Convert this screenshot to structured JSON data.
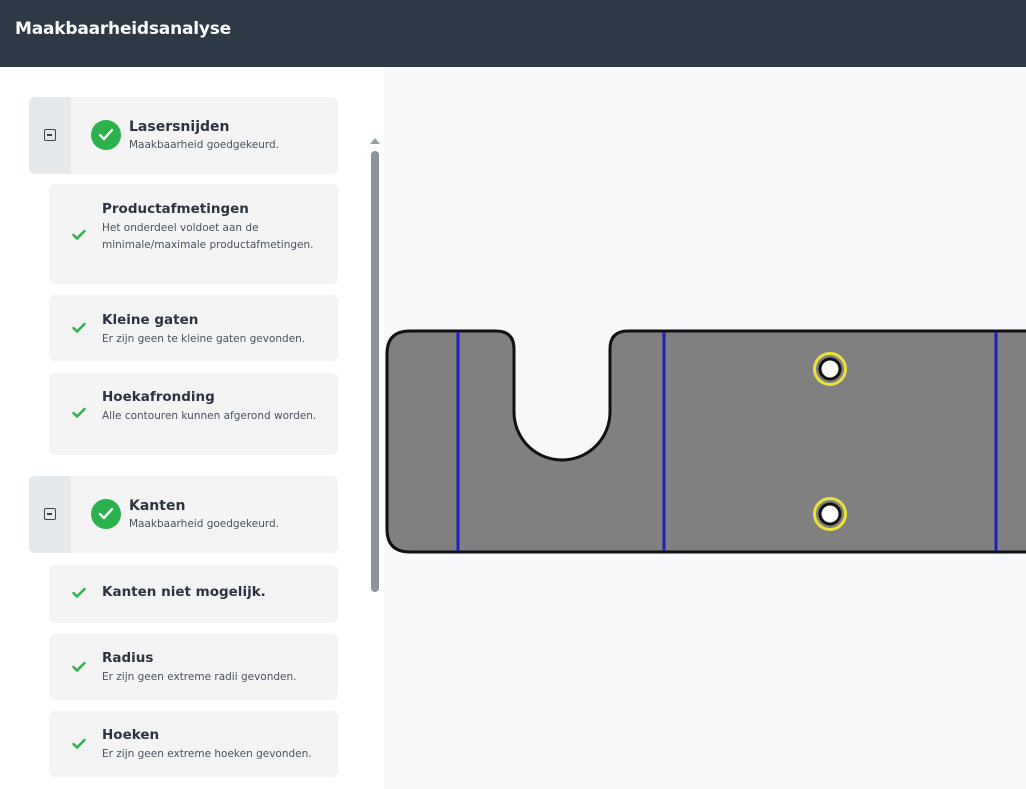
{
  "header": {
    "title": "Maakbaarheidsanalyse"
  },
  "sidebar": {
    "groups": [
      {
        "title": "Lasersnijden",
        "subtitle": "Maakbaarheid goedgekeurd.",
        "status": "approved",
        "items": [
          {
            "title": "Productafmetingen",
            "description": "Het onderdeel voldoet aan de minimale/maximale productafmetingen."
          },
          {
            "title": "Kleine gaten",
            "description": "Er zijn geen te kleine gaten gevonden."
          },
          {
            "title": "Hoekafronding",
            "description": "Alle contouren kunnen afgerond worden."
          }
        ]
      },
      {
        "title": "Kanten",
        "subtitle": "Maakbaarheid goedgekeurd.",
        "status": "approved",
        "items": [
          {
            "title": "Kanten niet mogelijk.",
            "description": ""
          },
          {
            "title": "Radius",
            "description": "Er zijn geen extreme radii gevonden."
          },
          {
            "title": "Hoeken",
            "description": "Er zijn geen extreme hoeken gevonden."
          }
        ]
      }
    ]
  },
  "icons": {
    "group_toggle": "collapse-minus-icon",
    "group_status": "check-circle-icon",
    "item_status": "check-icon"
  },
  "colors": {
    "header_bg": "#2d3a45",
    "success": "#2bb24c",
    "part_fill": "#808080",
    "bend_line": "#1f1fb8",
    "hole_highlight": "#e8e23a"
  }
}
